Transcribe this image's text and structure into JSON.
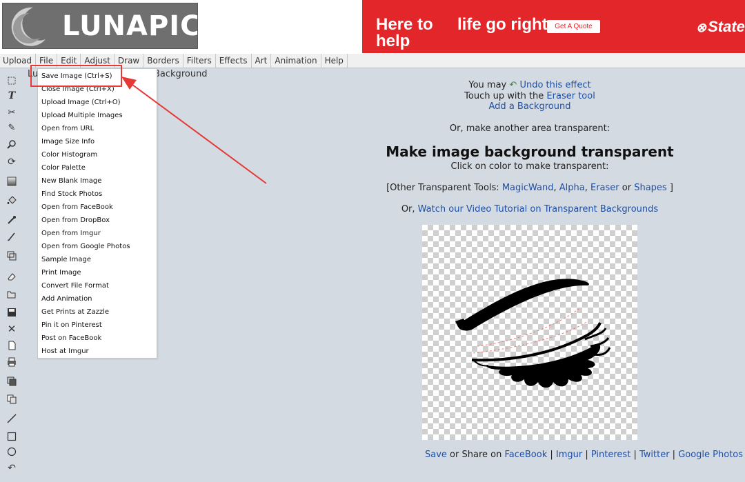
{
  "header": {
    "logo_text": "LUNAPIC",
    "ad": {
      "line1": "Here to help",
      "line2": "life go right",
      "button": "Get A Quote",
      "brand": "State"
    }
  },
  "menubar": [
    "Upload",
    "File",
    "Edit",
    "Adjust",
    "Draw",
    "Borders",
    "Filters",
    "Effects",
    "Art",
    "Animation",
    "Help"
  ],
  "behind_text": {
    "left": "Lu",
    "right": "Background"
  },
  "file_menu": [
    "Save Image (Ctrl+S)",
    "Close Image (Ctrl+X)",
    "Upload Image (Ctrl+O)",
    "Upload Multiple Images",
    "Open from URL",
    "Image Size Info",
    "Color Histogram",
    "Color Palette",
    "New Blank Image",
    "Find Stock Photos",
    "Open from FaceBook",
    "Open from DropBox",
    "Open from Imgur",
    "Open from Google Photos",
    "Sample Image",
    "Print Image",
    "Convert File Format",
    "Add Animation",
    "Get Prints at Zazzle",
    "Pin it on Pinterest",
    "Post on FaceBook",
    "Host at Imgur"
  ],
  "toolbar_icons": [
    "select-icon",
    "text-icon",
    "scissors-icon",
    "pencil-icon",
    "zoom-icon",
    "rotate-icon",
    "gradient-icon",
    "paint-bucket-icon",
    "eyedropper-icon",
    "brush-icon",
    "crop-icon",
    "eraser-icon",
    "open-folder-icon",
    "save-icon",
    "close-icon",
    "new-page-icon",
    "print-icon",
    "layers-icon",
    "copy-icon",
    "line-icon",
    "rectangle-icon",
    "circle-icon",
    "undo-icon"
  ],
  "main": {
    "undo_prefix": "You may ",
    "undo_link": "Undo this effect",
    "touch_prefix": "Touch up with the ",
    "eraser_link": "Eraser tool",
    "add_bg_link": "Add a Background",
    "another_area": "Or, make another area transparent:",
    "title": "Make image background transparent",
    "click_color": "Click on color to make transparent:",
    "other_tools_prefix": "[Other Transparent Tools: ",
    "tools": [
      "MagicWand",
      "Alpha",
      "Eraser",
      "Shapes"
    ],
    "other_tools_suffix": " ]",
    "video_prefix": "Or, ",
    "video_link": "Watch our Video Tutorial on Transparent Backgrounds"
  },
  "share": {
    "save": "Save",
    "middle": " or Share on ",
    "facebook": "FaceBook",
    "imgur": "Imgur",
    "pinterest": "Pinterest",
    "twitter": "Twitter",
    "google": "Google Photos"
  },
  "colors": {
    "ad_red": "#e3262a",
    "link_blue": "#1f4fa3",
    "annotation_red": "#e53935",
    "page_bg": "#d3dae2"
  }
}
